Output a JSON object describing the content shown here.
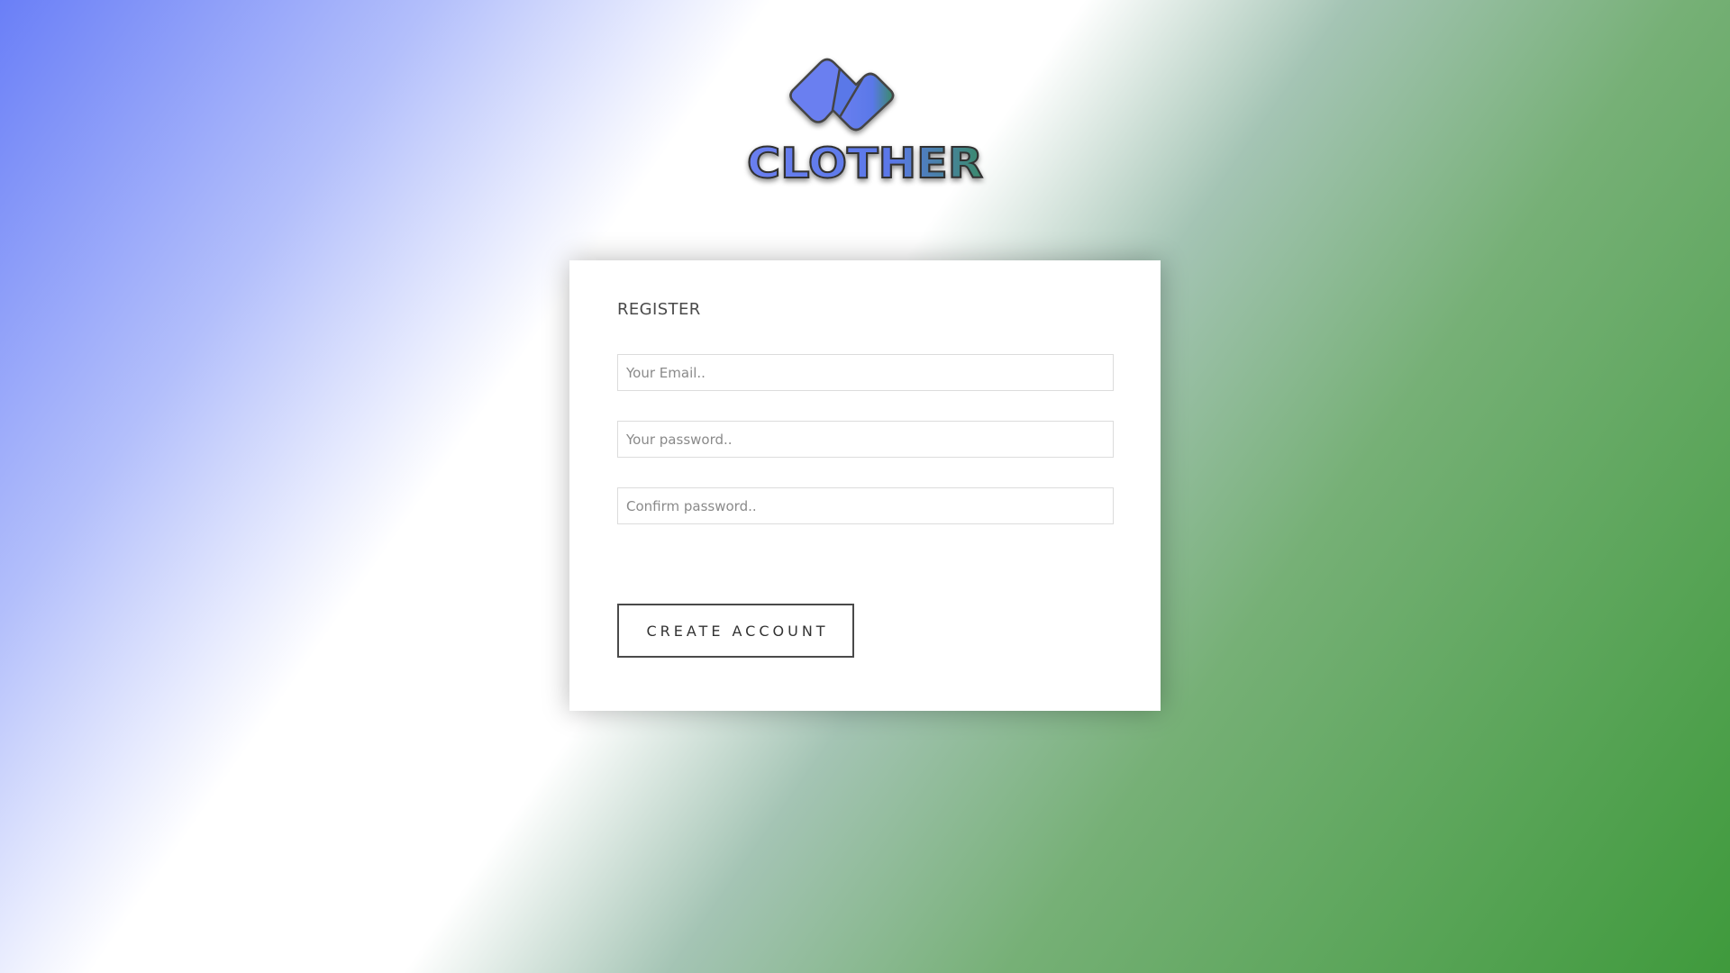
{
  "logo": {
    "text": "CLOTHER",
    "icon": "chevron-logo-icon",
    "colors": {
      "primary": "#6a7ff0",
      "secondary": "#3a8a6a",
      "outline": "#444444"
    }
  },
  "register": {
    "title": "REGISTER",
    "email_placeholder": "Your Email..",
    "password_placeholder": "Your password..",
    "confirm_placeholder": "Confirm password..",
    "submit_label": "CREATE ACCOUNT"
  },
  "theme": {
    "gradient_start": "#6a7ff7",
    "gradient_mid": "#ffffff",
    "gradient_end": "#3f9a3c"
  }
}
